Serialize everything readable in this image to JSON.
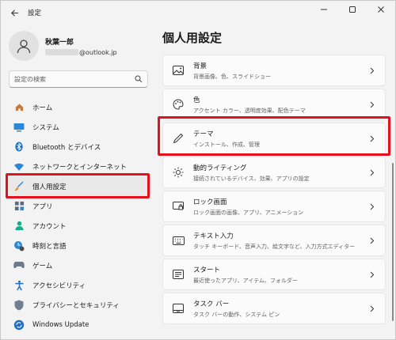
{
  "window": {
    "title": "設定"
  },
  "profile": {
    "name": "秋葉一郎",
    "email_visible": "@outlook.jp"
  },
  "search": {
    "placeholder": "設定の検索"
  },
  "sidebar": {
    "items": [
      {
        "label": "ホーム",
        "icon": "home-icon"
      },
      {
        "label": "システム",
        "icon": "system-icon"
      },
      {
        "label": "Bluetooth とデバイス",
        "icon": "bluetooth-icon"
      },
      {
        "label": "ネットワークとインターネット",
        "icon": "network-icon"
      },
      {
        "label": "個人用設定",
        "icon": "brush-icon",
        "selected": true
      },
      {
        "label": "アプリ",
        "icon": "apps-icon"
      },
      {
        "label": "アカウント",
        "icon": "account-icon"
      },
      {
        "label": "時刻と言語",
        "icon": "time-language-icon"
      },
      {
        "label": "ゲーム",
        "icon": "gaming-icon"
      },
      {
        "label": "アクセシビリティ",
        "icon": "accessibility-icon"
      },
      {
        "label": "プライバシーとセキュリティ",
        "icon": "shield-icon"
      },
      {
        "label": "Windows Update",
        "icon": "update-icon"
      }
    ]
  },
  "main": {
    "title": "個人用設定",
    "cards": [
      {
        "title": "背景",
        "sub": "背景画像、色、スライドショー",
        "icon": "image-icon"
      },
      {
        "title": "色",
        "sub": "アクセント カラー、透明度効果、配色テーマ",
        "icon": "palette-icon"
      },
      {
        "title": "テーマ",
        "sub": "インストール、作成、管理",
        "icon": "pen-icon"
      },
      {
        "title": "動的ライティング",
        "sub": "接続されているデバイス、効果、アプリの設定",
        "icon": "sun-icon"
      },
      {
        "title": "ロック画面",
        "sub": "ロック画面の画像、アプリ、アニメーション",
        "icon": "lock-screen-icon"
      },
      {
        "title": "テキスト入力",
        "sub": "タッチ キーボード、音声入力、絵文字など、入力方式エディター",
        "icon": "keyboard-icon"
      },
      {
        "title": "スタート",
        "sub": "最近使ったアプリ、アイテム、フォルダー",
        "icon": "start-icon"
      },
      {
        "title": "タスク バー",
        "sub": "タスク バーの動作、システム ピン",
        "icon": "taskbar-icon"
      }
    ]
  },
  "colors": {
    "accent": "#0067c0",
    "highlight_box": "#e3101d",
    "background": "#f3f3f3",
    "card": "#fbfbfb"
  }
}
